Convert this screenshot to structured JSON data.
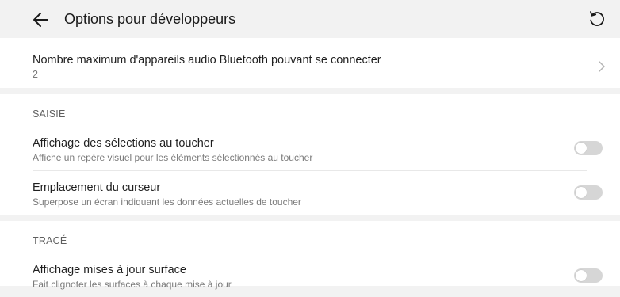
{
  "header": {
    "back_icon": "arrow-left-icon",
    "title": "Options pour développeurs",
    "refresh_icon": "refresh-icon"
  },
  "bluetooth": {
    "title": "Nombre maximum d'appareils audio Bluetooth pouvant se connecter",
    "value": "2",
    "chevron_icon": "chevron-right-icon"
  },
  "saisie": {
    "header": "SAISIE",
    "items": [
      {
        "title": "Affichage des sélections au toucher",
        "subtitle": "Affiche un repère visuel pour les éléments sélectionnés au toucher",
        "enabled": false
      },
      {
        "title": "Emplacement du curseur",
        "subtitle": "Superpose un écran indiquant les données actuelles de toucher",
        "enabled": false
      }
    ]
  },
  "trace": {
    "header": "TRACÉ",
    "items": [
      {
        "title": "Affichage mises à jour surface",
        "subtitle": "Fait clignoter les surfaces à chaque mise à jour",
        "enabled": false
      }
    ]
  },
  "colors": {
    "background": "#f2f2f2",
    "card": "#ffffff",
    "toggle_off": "#d6d6d6",
    "secondary_text": "#7a7a7a"
  }
}
